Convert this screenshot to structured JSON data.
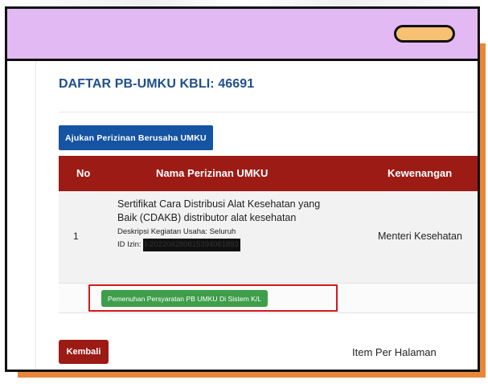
{
  "page": {
    "title": "DAFTAR PB-UMKU KBLI: 46691"
  },
  "buttons": {
    "ajukan": "Ajukan Perizinan Berusaha UMKU",
    "pemenuhan": "Pemenuhan Persyaratan PB UMKU Di Sistem K/L",
    "kembali": "Kembali"
  },
  "table": {
    "headers": [
      "No",
      "Nama Perizinan UMKU",
      "Kewenangan"
    ],
    "rows": [
      {
        "no": "1",
        "nama": "Sertifikat Cara Distribusi Alat Kesehatan yang Baik (CDAKB) distributor alat kesehatan",
        "deskripsi": "Deskripsi Kegiatan Usaha: Seluruh",
        "id_label": "ID Izin: ",
        "id_value": "I-202204280815394061893",
        "kewenangan": "Menteri Kesehatan"
      }
    ]
  },
  "footer": {
    "item_per_halaman": "Item Per Halaman"
  },
  "colors": {
    "header_bar": "#e3b9f3",
    "pill": "#f7c072",
    "shadow": "#e8863a",
    "title_blue": "#1f4f8c",
    "primary_button": "#1553a3",
    "table_header": "#9c1b15",
    "success_button": "#3f9e4a",
    "highlight": "#d4181c"
  }
}
